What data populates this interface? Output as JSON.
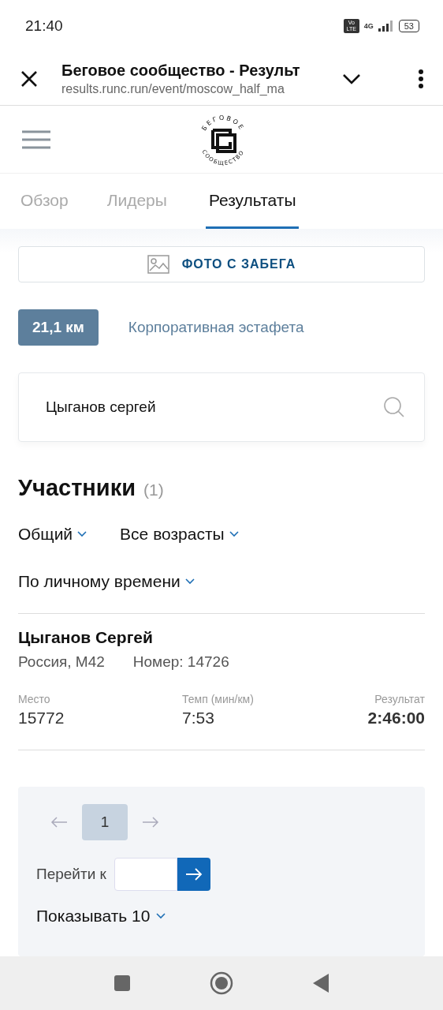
{
  "status_bar": {
    "time": "21:40",
    "volte": "Vo LTE",
    "network": "4G",
    "battery": "53"
  },
  "browser_bar": {
    "title": "Беговое сообщество - Результ",
    "url": "results.runc.run/event/moscow_half_ma"
  },
  "logo": {
    "top_text": "БЕГОВОЕ",
    "bottom_text": "СООБЩЕСТВО"
  },
  "tabs": [
    {
      "label": "Обзор",
      "selected": false
    },
    {
      "label": "Лидеры",
      "selected": false
    },
    {
      "label": "Результаты",
      "selected": true
    }
  ],
  "photo_button": {
    "label": "ФОТО С ЗАБЕГА"
  },
  "distances": [
    {
      "label": "21,1 км",
      "selected": true
    },
    {
      "label": "Корпоративная эстафета",
      "selected": false
    }
  ],
  "search": {
    "value": "Цыганов сергей"
  },
  "participants": {
    "title": "Участники",
    "count": "(1)"
  },
  "filters": [
    {
      "label": "Общий"
    },
    {
      "label": "Все возрасты"
    },
    {
      "label": "По личному времени"
    }
  ],
  "results": [
    {
      "name": "Цыганов Сергей",
      "country_group": "Россия, М42",
      "bib": "Номер: 14726",
      "place_label": "Место",
      "place": "15772",
      "pace_label": "Темп (мин/км)",
      "pace": "7:53",
      "result_label": "Результат",
      "result": "2:46:00"
    }
  ],
  "pagination": {
    "pages": [
      {
        "label": "1",
        "selected": true
      }
    ],
    "goto_label": "Перейти к",
    "page_size": "Показывать 10"
  }
}
